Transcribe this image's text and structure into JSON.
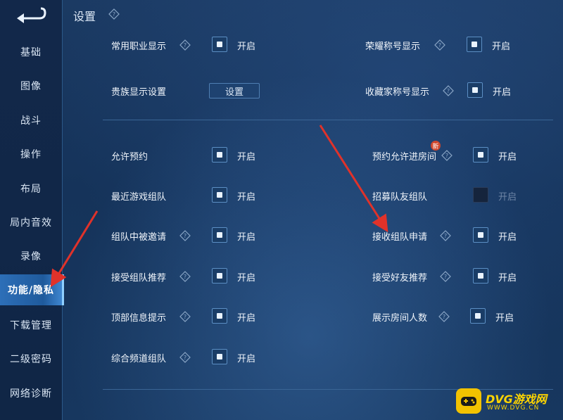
{
  "header": {
    "title": "设置"
  },
  "sidebar": {
    "items": [
      {
        "label": "基础"
      },
      {
        "label": "图像"
      },
      {
        "label": "战斗"
      },
      {
        "label": "操作"
      },
      {
        "label": "布局"
      },
      {
        "label": "局内音效"
      },
      {
        "label": "录像"
      },
      {
        "label": "功能/隐私",
        "active": true
      },
      {
        "label": "下载管理"
      },
      {
        "label": "二级密码"
      },
      {
        "label": "网络诊断"
      }
    ]
  },
  "settings": {
    "on_text": "开启",
    "set_button": "设置",
    "new_badge": "新",
    "rows": [
      {
        "label": "常用职业显示",
        "checked": true
      },
      {
        "label": "荣耀称号显示",
        "checked": true
      },
      {
        "label": "贵族显示设置"
      },
      {
        "label": "收藏家称号显示",
        "checked": true
      },
      {
        "label": "允许预约",
        "checked": true
      },
      {
        "label": "预约允许进房间",
        "checked": true
      },
      {
        "label": "最近游戏组队",
        "checked": true
      },
      {
        "label": "招募队友组队",
        "checked": false,
        "disabled": true
      },
      {
        "label": "组队中被邀请",
        "checked": true
      },
      {
        "label": "接收组队申请",
        "checked": true
      },
      {
        "label": "接受组队推荐",
        "checked": true
      },
      {
        "label": "接受好友推荐",
        "checked": true
      },
      {
        "label": "顶部信息提示",
        "checked": true
      },
      {
        "label": "展示房间人数",
        "checked": true
      },
      {
        "label": "综合频道组队",
        "checked": true
      }
    ]
  },
  "watermark": {
    "title": "DVG游戏网",
    "subtitle": "WWW.DVG.CN"
  },
  "colors": {
    "accent": "#2d6fb8",
    "arrow": "#e0322a",
    "badge": "#d0472d"
  }
}
